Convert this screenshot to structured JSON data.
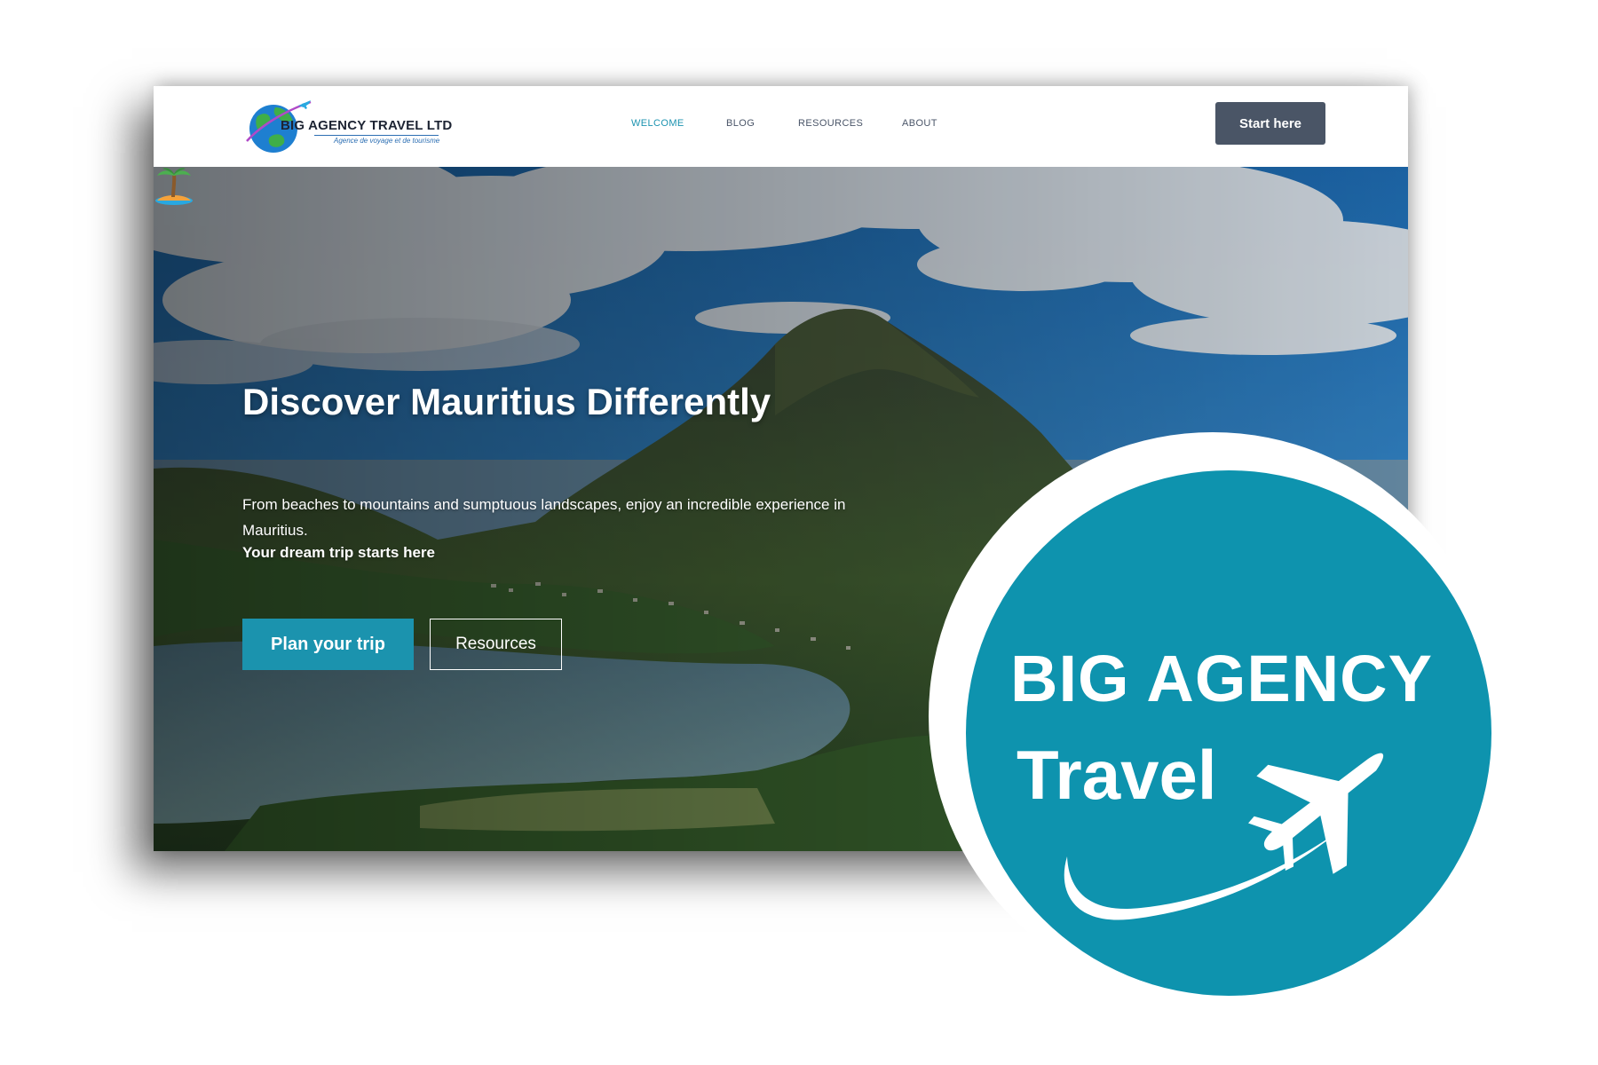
{
  "website": {
    "logo": {
      "name": "BIG AGENCY TRAVEL LTD",
      "tagline": "Agence de voyage et de tourisme"
    },
    "nav": {
      "items": [
        {
          "label": "WELCOME",
          "active": true
        },
        {
          "label": "BLOG",
          "active": false
        },
        {
          "label": "RESOURCES",
          "active": false
        },
        {
          "label": "ABOUT",
          "active": false
        }
      ],
      "cta_label": "Start here"
    },
    "hero": {
      "title": "Discover Mauritius Differently",
      "icon": "desert-island-icon",
      "description": "From beaches to mountains and sumptuous landscapes, enjoy an incredible experience in Mauritius.",
      "tagline": "Your dream trip starts here",
      "primary_button": "Plan your trip",
      "secondary_button": "Resources"
    }
  },
  "badge": {
    "line1": "BIG AGENCY",
    "line2": "Travel",
    "icon": "airplane-icon"
  },
  "colors": {
    "accent": "#1b93ae",
    "badge": "#0e93ae",
    "nav_button": "#4a5566",
    "nav_active": "#1c93b0"
  }
}
